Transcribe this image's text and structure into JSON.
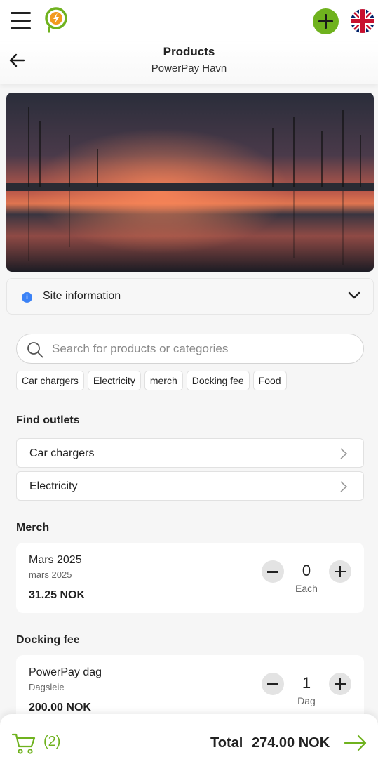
{
  "topbar": {
    "menu_icon": "hamburger-icon",
    "logo_icon": "powerpay-logo-icon",
    "add_icon": "plus-icon",
    "language_icon": "uk-flag-icon",
    "accent_color": "#6fb21e"
  },
  "header": {
    "back_icon": "arrow-left-icon",
    "title": "Products",
    "subtitle": "PowerPay Havn"
  },
  "hero": {
    "image": "marina-sunset-photo"
  },
  "site_info": {
    "label": "Site information",
    "info_icon": "i",
    "info_color": "#3b82f6"
  },
  "search": {
    "placeholder": "Search for products or categories",
    "value": ""
  },
  "chips": [
    "Car chargers",
    "Electricity",
    "merch",
    "Docking fee",
    "Food"
  ],
  "outlets": {
    "title": "Find outlets",
    "items": [
      "Car chargers",
      "Electricity"
    ]
  },
  "merch": {
    "title": "Merch",
    "product": {
      "name": "Mars 2025",
      "subtitle": "mars 2025",
      "price": "31.25 NOK",
      "quantity": "0",
      "unit": "Each"
    }
  },
  "docking": {
    "title": "Docking fee",
    "product": {
      "name": "PowerPay dag",
      "subtitle": "Dagsleie",
      "price": "200.00 NOK",
      "quantity": "1",
      "unit": "Dag"
    }
  },
  "footer": {
    "cart_icon": "cart-icon",
    "cart_count": "(2)",
    "total_label": "Total",
    "total_value": "274.00 NOK",
    "checkout_icon": "arrow-right-icon"
  }
}
